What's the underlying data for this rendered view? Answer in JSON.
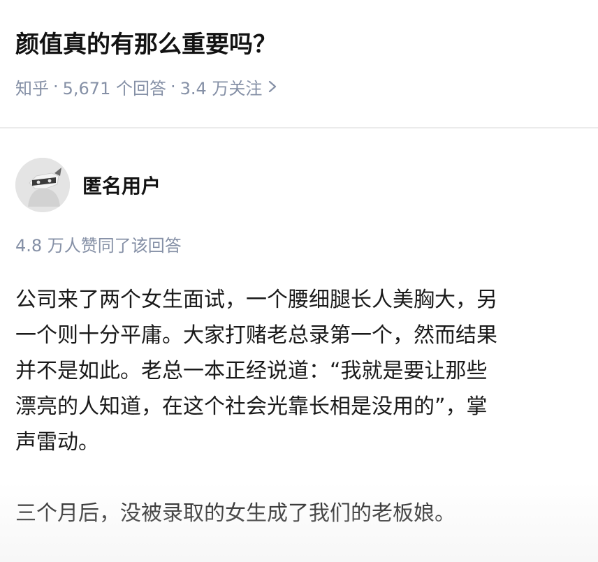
{
  "question": {
    "title": "颜值真的有那么重要吗？",
    "source": "知乎",
    "answer_count": "5,671 个回答",
    "follower_count": "3.4 万关注",
    "separator": "·"
  },
  "answer": {
    "author_name": "匿名用户",
    "vote_text": "4.8 万人赞同了该回答",
    "paragraph1_lines": [
      "公司来了两个女生面试，一个腰细腿长人美胸大，另",
      "一个则十分平庸。大家打赌老总录第一个，然而结果",
      "并不是如此。老总一本正经说道：“我就是要让那些",
      "漂亮的人知道，在这个社会光靠长相是没用的”，掌",
      "声雷动。"
    ],
    "paragraph2_lines": [
      "三个月后，没被录取的女生成了我们的老板娘。"
    ]
  },
  "icons": {
    "avatar": "anonymous-user-avatar-icon",
    "chevron": "chevron-right-icon"
  },
  "colors": {
    "title": "#121212",
    "meta": "#8590a6",
    "body": "#1a1a1a",
    "divider": "#ebebeb"
  }
}
